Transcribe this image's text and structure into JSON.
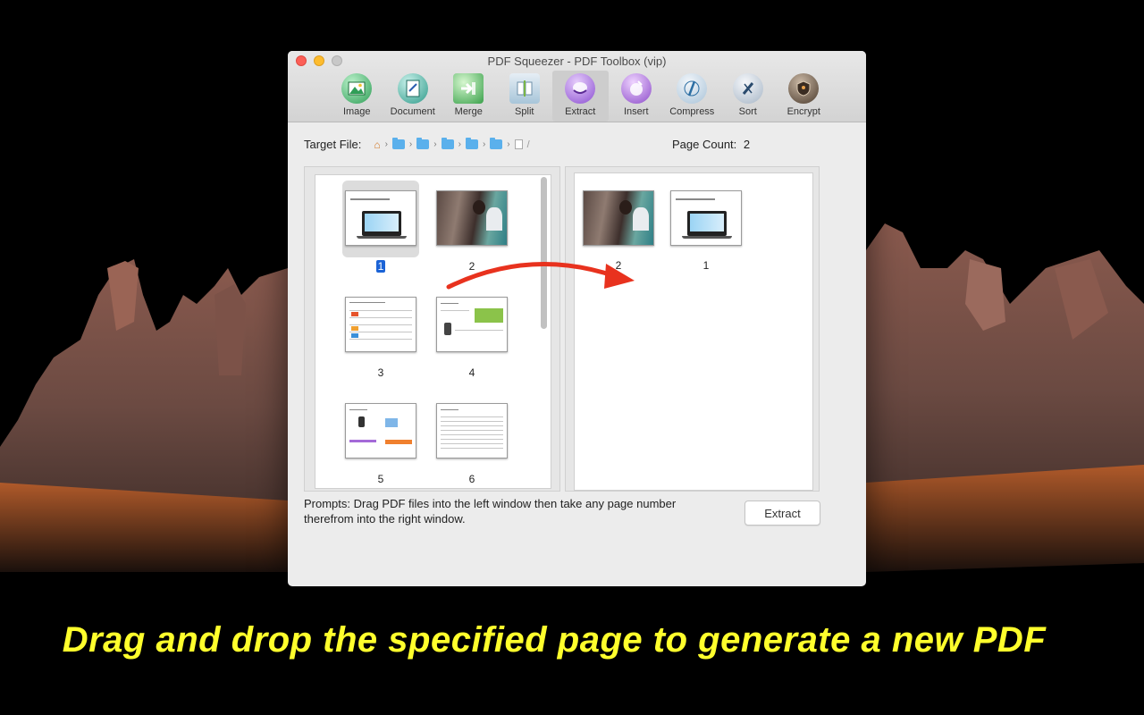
{
  "window": {
    "title": "PDF Squeezer - PDF Toolbox (vip)"
  },
  "toolbar": {
    "items": [
      {
        "label": "Image",
        "icon": "image-tool-icon",
        "color": "#2f9e57"
      },
      {
        "label": "Document",
        "icon": "document-tool-icon",
        "color": "#2e9a8a"
      },
      {
        "label": "Merge",
        "icon": "merge-tool-icon",
        "color": "#3aa14b"
      },
      {
        "label": "Split",
        "icon": "split-tool-icon",
        "color": "#a7c5d9"
      },
      {
        "label": "Extract",
        "icon": "extract-tool-icon",
        "color": "#8b4fd1"
      },
      {
        "label": "Insert",
        "icon": "insert-tool-icon",
        "color": "#8c4cc9"
      },
      {
        "label": "Compress",
        "icon": "compress-tool-icon",
        "color": "#2d6fa3"
      },
      {
        "label": "Sort",
        "icon": "sort-tool-icon",
        "color": "#2a4b6e"
      },
      {
        "label": "Encrypt",
        "icon": "encrypt-tool-icon",
        "color": "#4a3a2c"
      }
    ],
    "active": "Extract"
  },
  "target_file": {
    "label": "Target File:",
    "path_trailing": "/"
  },
  "page_count": {
    "label": "Page Count:",
    "value": "2"
  },
  "left_pages": [
    {
      "number": "1",
      "kind": "laptop",
      "selected": true
    },
    {
      "number": "2",
      "kind": "photo"
    },
    {
      "number": "3",
      "kind": "table"
    },
    {
      "number": "4",
      "kind": "doc-green"
    },
    {
      "number": "5",
      "kind": "doc-orange"
    },
    {
      "number": "6",
      "kind": "text"
    }
  ],
  "right_pages": [
    {
      "number": "2",
      "kind": "photo"
    },
    {
      "number": "1",
      "kind": "laptop"
    }
  ],
  "prompt": "Prompts: Drag PDF files into the left window then take any page number\n therefrom into the right window.",
  "extract_button": "Extract",
  "caption": "Drag and drop the specified page to generate a new PDF",
  "colors": {
    "caption": "#ffff2c",
    "arrow": "#e8321e",
    "selection": "#1b63d6"
  }
}
